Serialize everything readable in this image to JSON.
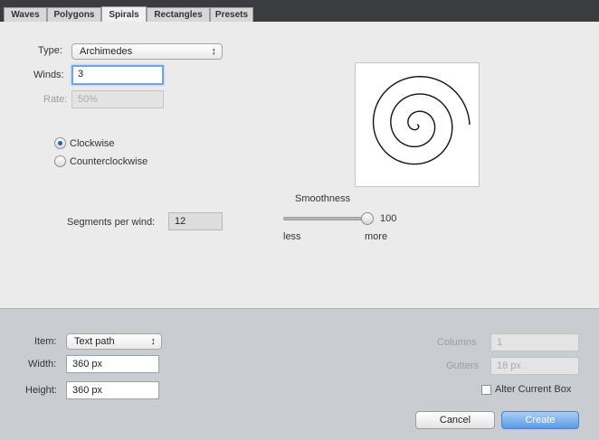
{
  "tabs": [
    {
      "label": "Waves",
      "active": false
    },
    {
      "label": "Polygons",
      "active": false
    },
    {
      "label": "Spirals",
      "active": true
    },
    {
      "label": "Rectangles",
      "active": false
    },
    {
      "label": "Presets",
      "active": false
    }
  ],
  "spiral": {
    "type_label": "Type:",
    "type_value": "Archimedes",
    "winds_label": "Winds:",
    "winds_value": "3",
    "rate_label": "Rate:",
    "rate_value": "50%",
    "clockwise_label": "Clockwise",
    "counterclockwise_label": "Counterclockwise",
    "direction_selected": "clockwise",
    "segments_label": "Segments per wind:",
    "segments_value": "12",
    "smoothness_label": "Smoothness",
    "smoothness_value": "100",
    "smoothness_fraction": 1.0,
    "less_label": "less",
    "more_label": "more",
    "preview_winds": 3
  },
  "item": {
    "item_label": "Item:",
    "item_value": "Text path",
    "width_label": "Width:",
    "width_value": "360 px",
    "height_label": "Height:",
    "height_value": "360 px",
    "columns_label": "Columns",
    "columns_value": "1",
    "gutters_label": "Gutters",
    "gutters_value": "18 px",
    "alter_label": "Alter Current Box",
    "alter_checked": false
  },
  "buttons": {
    "cancel": "Cancel",
    "create": "Create"
  },
  "colors": {
    "accent": "#5b9be4",
    "focus": "#6fa5e8"
  }
}
